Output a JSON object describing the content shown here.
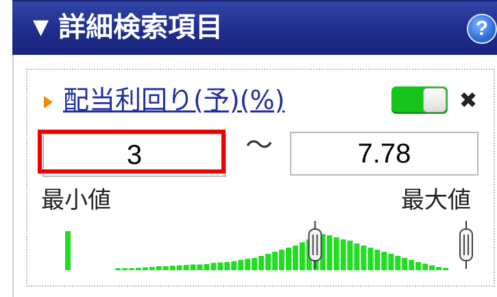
{
  "header": {
    "title": "詳細検索項目",
    "toggle_symbol": "▼",
    "help_symbol": "?"
  },
  "filter": {
    "field_label": "配当利回り(予)(%)",
    "enabled": true,
    "remove_symbol": "✖",
    "min_value": "3",
    "max_value": "7.78",
    "range_separator": "～",
    "min_label": "最小値",
    "max_label": "最大値"
  },
  "colors": {
    "header": "#1f2d8c",
    "accent_toggle": "#17c51a",
    "highlight": "#ee0000",
    "histogram_bar": "#22dd22",
    "link": "#1f2fa0"
  },
  "histogram": {
    "min_slider_fraction": 0.62,
    "max_slider_fraction": 1.0,
    "outlier_bar_height": 0.95,
    "bars": [
      0.05,
      0.05,
      0.05,
      0.06,
      0.07,
      0.08,
      0.1,
      0.1,
      0.11,
      0.12,
      0.13,
      0.14,
      0.14,
      0.15,
      0.18,
      0.19,
      0.2,
      0.22,
      0.25,
      0.28,
      0.3,
      0.35,
      0.4,
      0.45,
      0.5,
      0.55,
      0.6,
      0.68,
      0.75,
      0.8,
      0.88,
      0.85,
      0.8,
      0.75,
      0.72,
      0.65,
      0.6,
      0.55,
      0.5,
      0.45,
      0.4,
      0.35,
      0.3,
      0.25,
      0.2,
      0.16,
      0.12,
      0.08,
      0.06
    ]
  },
  "icons": [
    "collapse-triangle-icon",
    "help-icon",
    "orange-arrow-icon",
    "toggle-switch",
    "close-icon",
    "slider-handle-icon"
  ]
}
